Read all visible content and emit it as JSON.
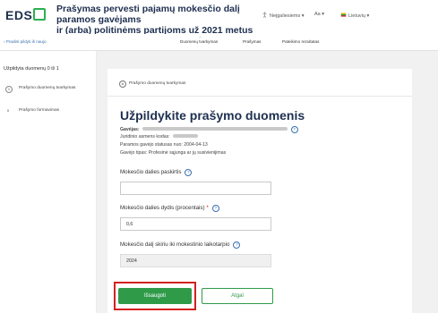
{
  "header": {
    "logo_text": "EDS",
    "title_line1": "Prašymas pervesti pajamų mokesčio dalį paramos gavėjams",
    "title_line2": "ir (arba) politinėms partijoms už 2021 metus",
    "account_label": "Neįgaliesiems",
    "font_size_label": "Aa",
    "language_label": "Lietuvių"
  },
  "nav": {
    "back_link": "Pradėti pildyti iš naujo",
    "tabs": [
      "Duomenų tvarkymas",
      "Prašymas",
      "Pateikimo rezultatas"
    ]
  },
  "sidebar": {
    "heading": "Užpildyta duomenų 0 iš 1",
    "steps": [
      {
        "num": "1",
        "label": "Prašymo duomenų tvarkymas"
      },
      {
        "num": "0",
        "label": "Prašymo formavimas"
      }
    ]
  },
  "breadcrumb": {
    "num": "A",
    "label": "Prašymo duomenų tvarkymas"
  },
  "main": {
    "heading": "Užpildykite prašymo duomenis",
    "receiver_label": "Gavėjas:",
    "legal_code_label": "Juridinio asmens kodas:",
    "status_line": "Paramos gavėjo statusas nuo: 2004-04-13",
    "type_line": "Gavėjo tipas: Profesinė sąjunga ar jų susivienijimas"
  },
  "form": {
    "purpose_label": "Mokesčio dalies paskirtis",
    "purpose_value": "",
    "percent_label": "Mokesčio dalies dydis (procentais)",
    "percent_required": "*",
    "percent_value": "0,6",
    "period_label": "Mokesčio dalį skiriu iki mokestinio laikotarpio",
    "period_value": "2024"
  },
  "buttons": {
    "save": "Išsaugoti",
    "back": "Atgal"
  },
  "colors": {
    "accent": "#2f9b49",
    "brand": "#1d2f4f",
    "highlight": "#d42020"
  }
}
